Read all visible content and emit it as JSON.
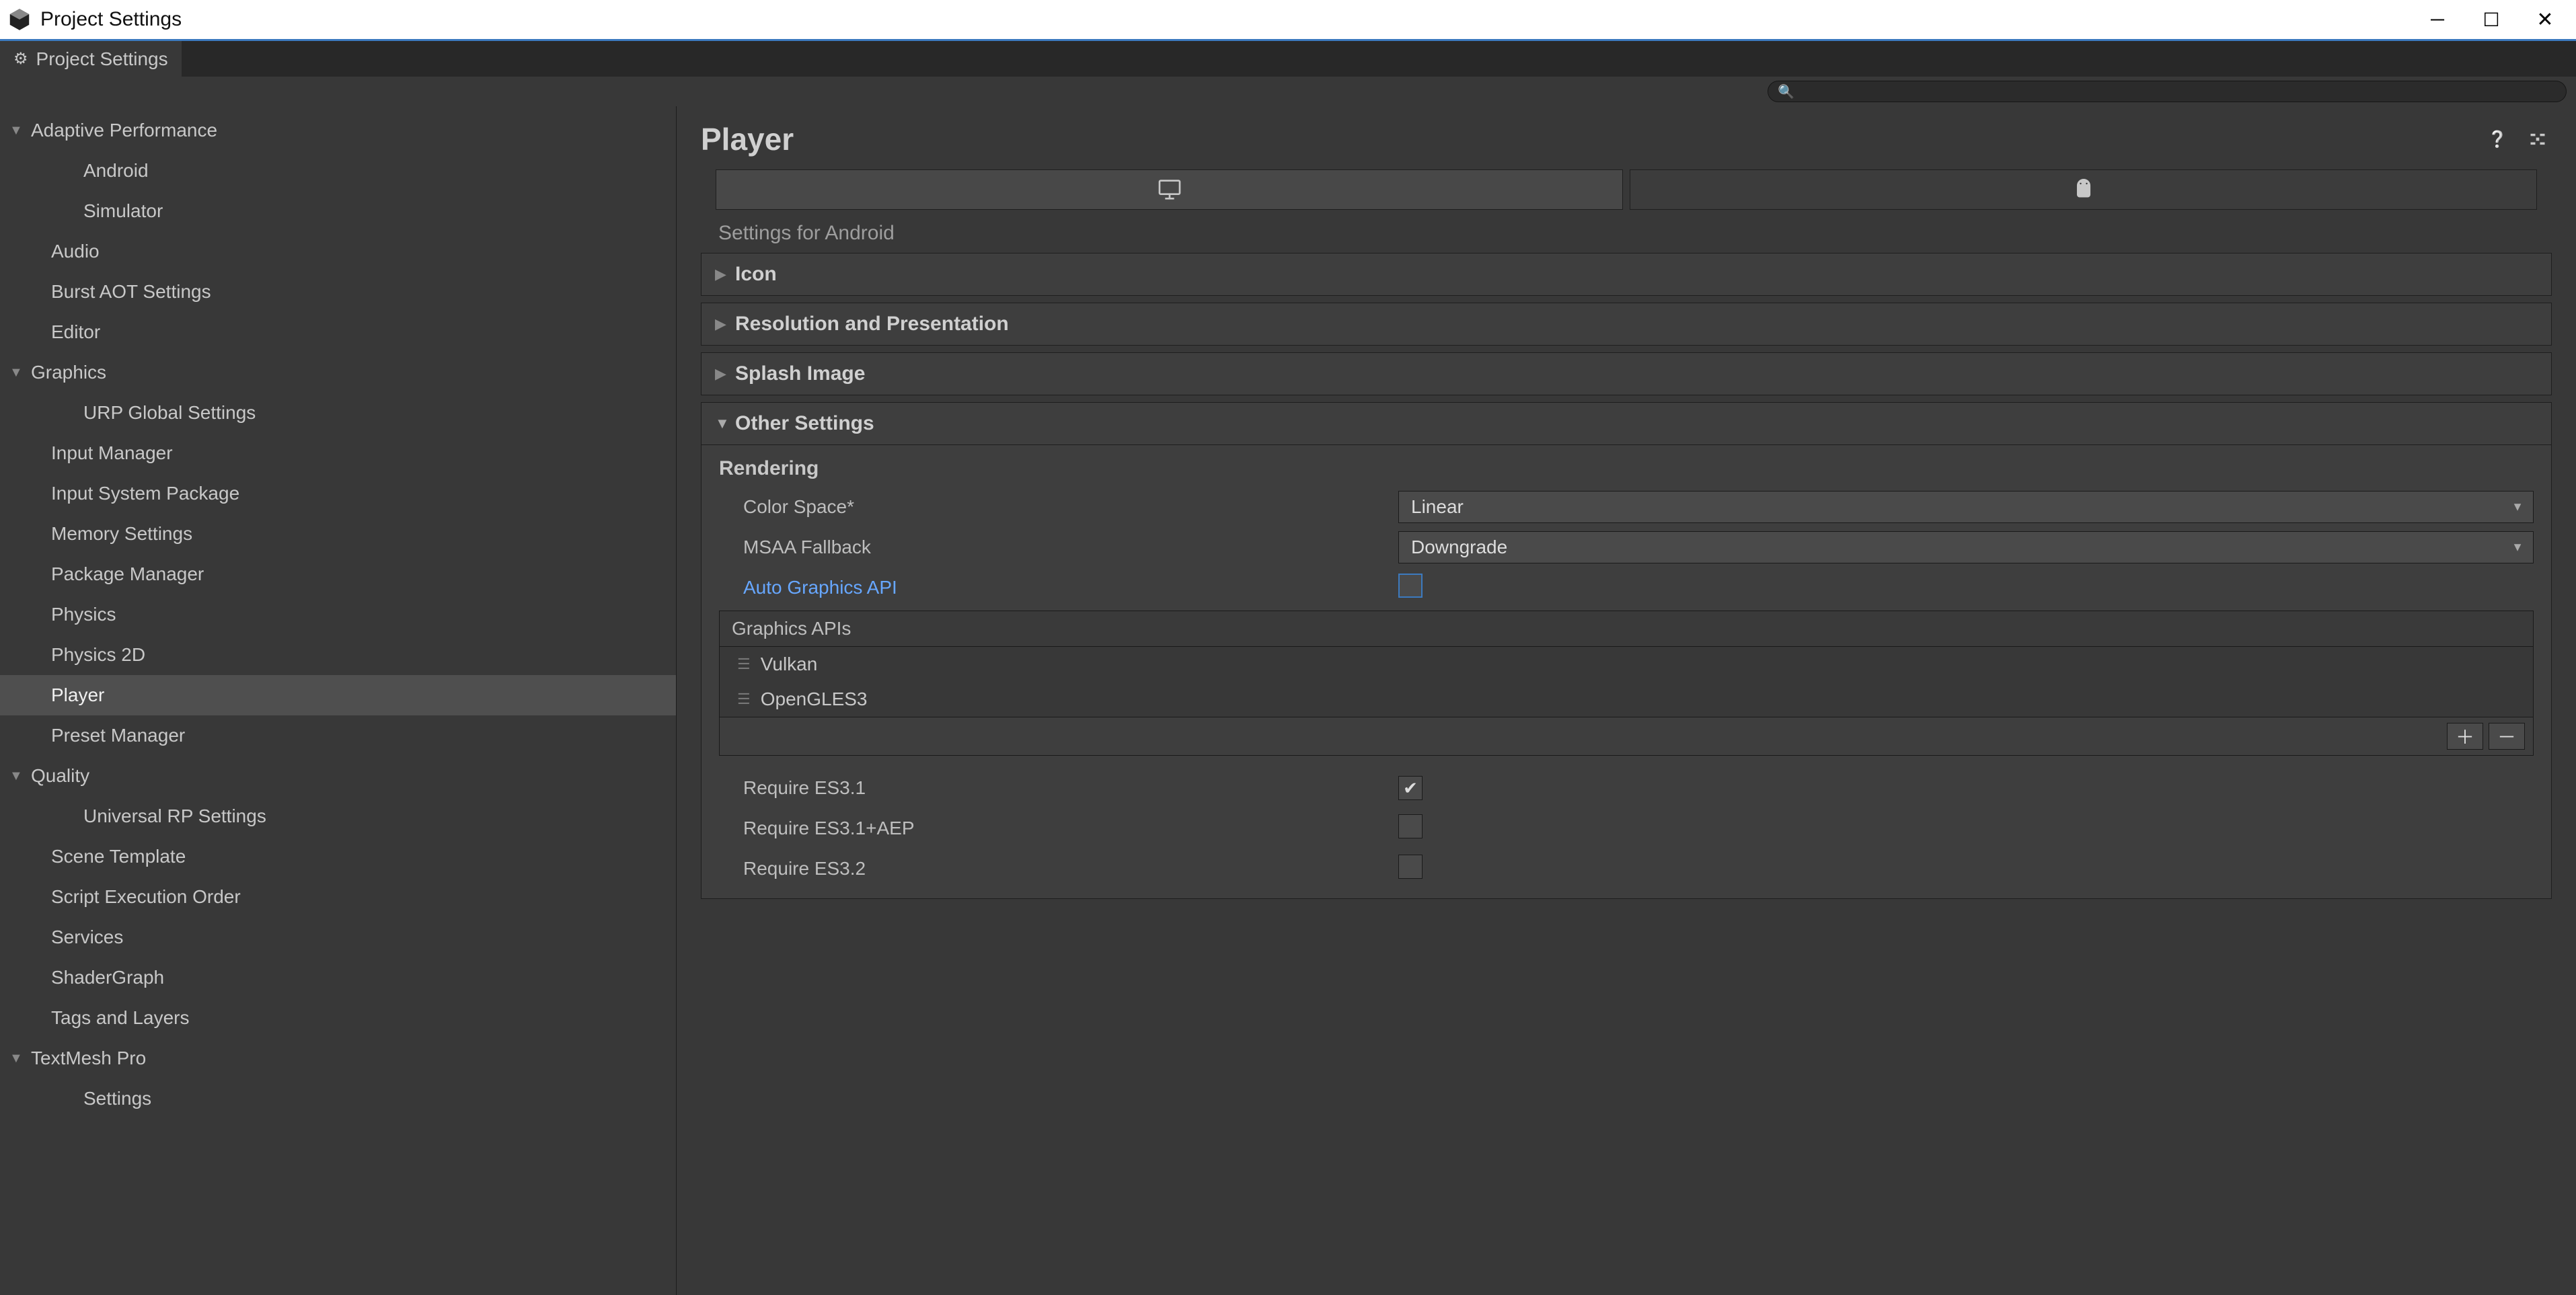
{
  "window": {
    "title": "Project Settings"
  },
  "tab": {
    "label": "Project Settings"
  },
  "search": {
    "placeholder": ""
  },
  "sidebar": {
    "items": [
      {
        "label": "Adaptive Performance",
        "expandable": true,
        "expanded": true,
        "depth": 0
      },
      {
        "label": "Android",
        "depth": 1
      },
      {
        "label": "Simulator",
        "depth": 1
      },
      {
        "label": "Audio",
        "depth": 0
      },
      {
        "label": "Burst AOT Settings",
        "depth": 0
      },
      {
        "label": "Editor",
        "depth": 0
      },
      {
        "label": "Graphics",
        "expandable": true,
        "expanded": true,
        "depth": 0
      },
      {
        "label": "URP Global Settings",
        "depth": 1
      },
      {
        "label": "Input Manager",
        "depth": 0
      },
      {
        "label": "Input System Package",
        "depth": 0
      },
      {
        "label": "Memory Settings",
        "depth": 0
      },
      {
        "label": "Package Manager",
        "depth": 0
      },
      {
        "label": "Physics",
        "depth": 0
      },
      {
        "label": "Physics 2D",
        "depth": 0
      },
      {
        "label": "Player",
        "depth": 0,
        "selected": true
      },
      {
        "label": "Preset Manager",
        "depth": 0
      },
      {
        "label": "Quality",
        "expandable": true,
        "expanded": true,
        "depth": 0
      },
      {
        "label": "Universal RP Settings",
        "depth": 1
      },
      {
        "label": "Scene Template",
        "depth": 0
      },
      {
        "label": "Script Execution Order",
        "depth": 0
      },
      {
        "label": "Services",
        "depth": 0
      },
      {
        "label": "ShaderGraph",
        "depth": 0
      },
      {
        "label": "Tags and Layers",
        "depth": 0
      },
      {
        "label": "TextMesh Pro",
        "expandable": true,
        "expanded": true,
        "depth": 0
      },
      {
        "label": "Settings",
        "depth": 1
      }
    ]
  },
  "main": {
    "title": "Player",
    "settings_for": "Settings for Android",
    "folds": {
      "icon": "Icon",
      "resolution": "Resolution and Presentation",
      "splash": "Splash Image",
      "other": "Other Settings"
    },
    "rendering": {
      "heading": "Rendering",
      "color_space_label": "Color Space*",
      "color_space_value": "Linear",
      "msaa_label": "MSAA Fallback",
      "msaa_value": "Downgrade",
      "auto_gapi_label": "Auto Graphics API",
      "auto_gapi_checked": false,
      "gapi_header": "Graphics APIs",
      "gapi_items": [
        "Vulkan",
        "OpenGLES3"
      ],
      "req_es31_label": "Require ES3.1",
      "req_es31_checked": true,
      "req_es31aep_label": "Require ES3.1+AEP",
      "req_es31aep_checked": false,
      "req_es32_label": "Require ES3.2",
      "req_es32_checked": false
    }
  }
}
